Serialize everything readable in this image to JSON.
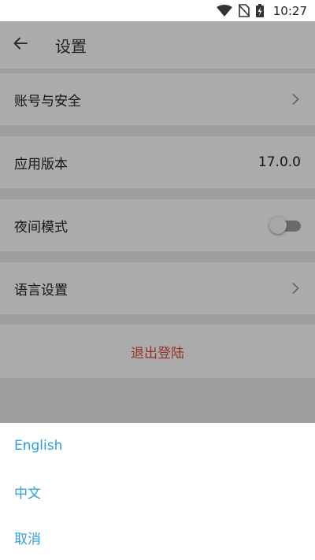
{
  "status_bar": {
    "time": "10:27"
  },
  "header": {
    "title": "设置"
  },
  "settings": {
    "account_security": {
      "label": "账号与安全"
    },
    "app_version": {
      "label": "应用版本",
      "value": "17.0.0"
    },
    "night_mode": {
      "label": "夜间模式",
      "enabled": false
    },
    "language": {
      "label": "语言设置"
    },
    "logout": {
      "label": "退出登陆"
    }
  },
  "language_sheet": {
    "options": [
      {
        "label": "English"
      },
      {
        "label": "中文"
      }
    ],
    "cancel_label": "取消"
  },
  "colors": {
    "accent": "#2f9ed9",
    "logout": "#e04a3d"
  }
}
